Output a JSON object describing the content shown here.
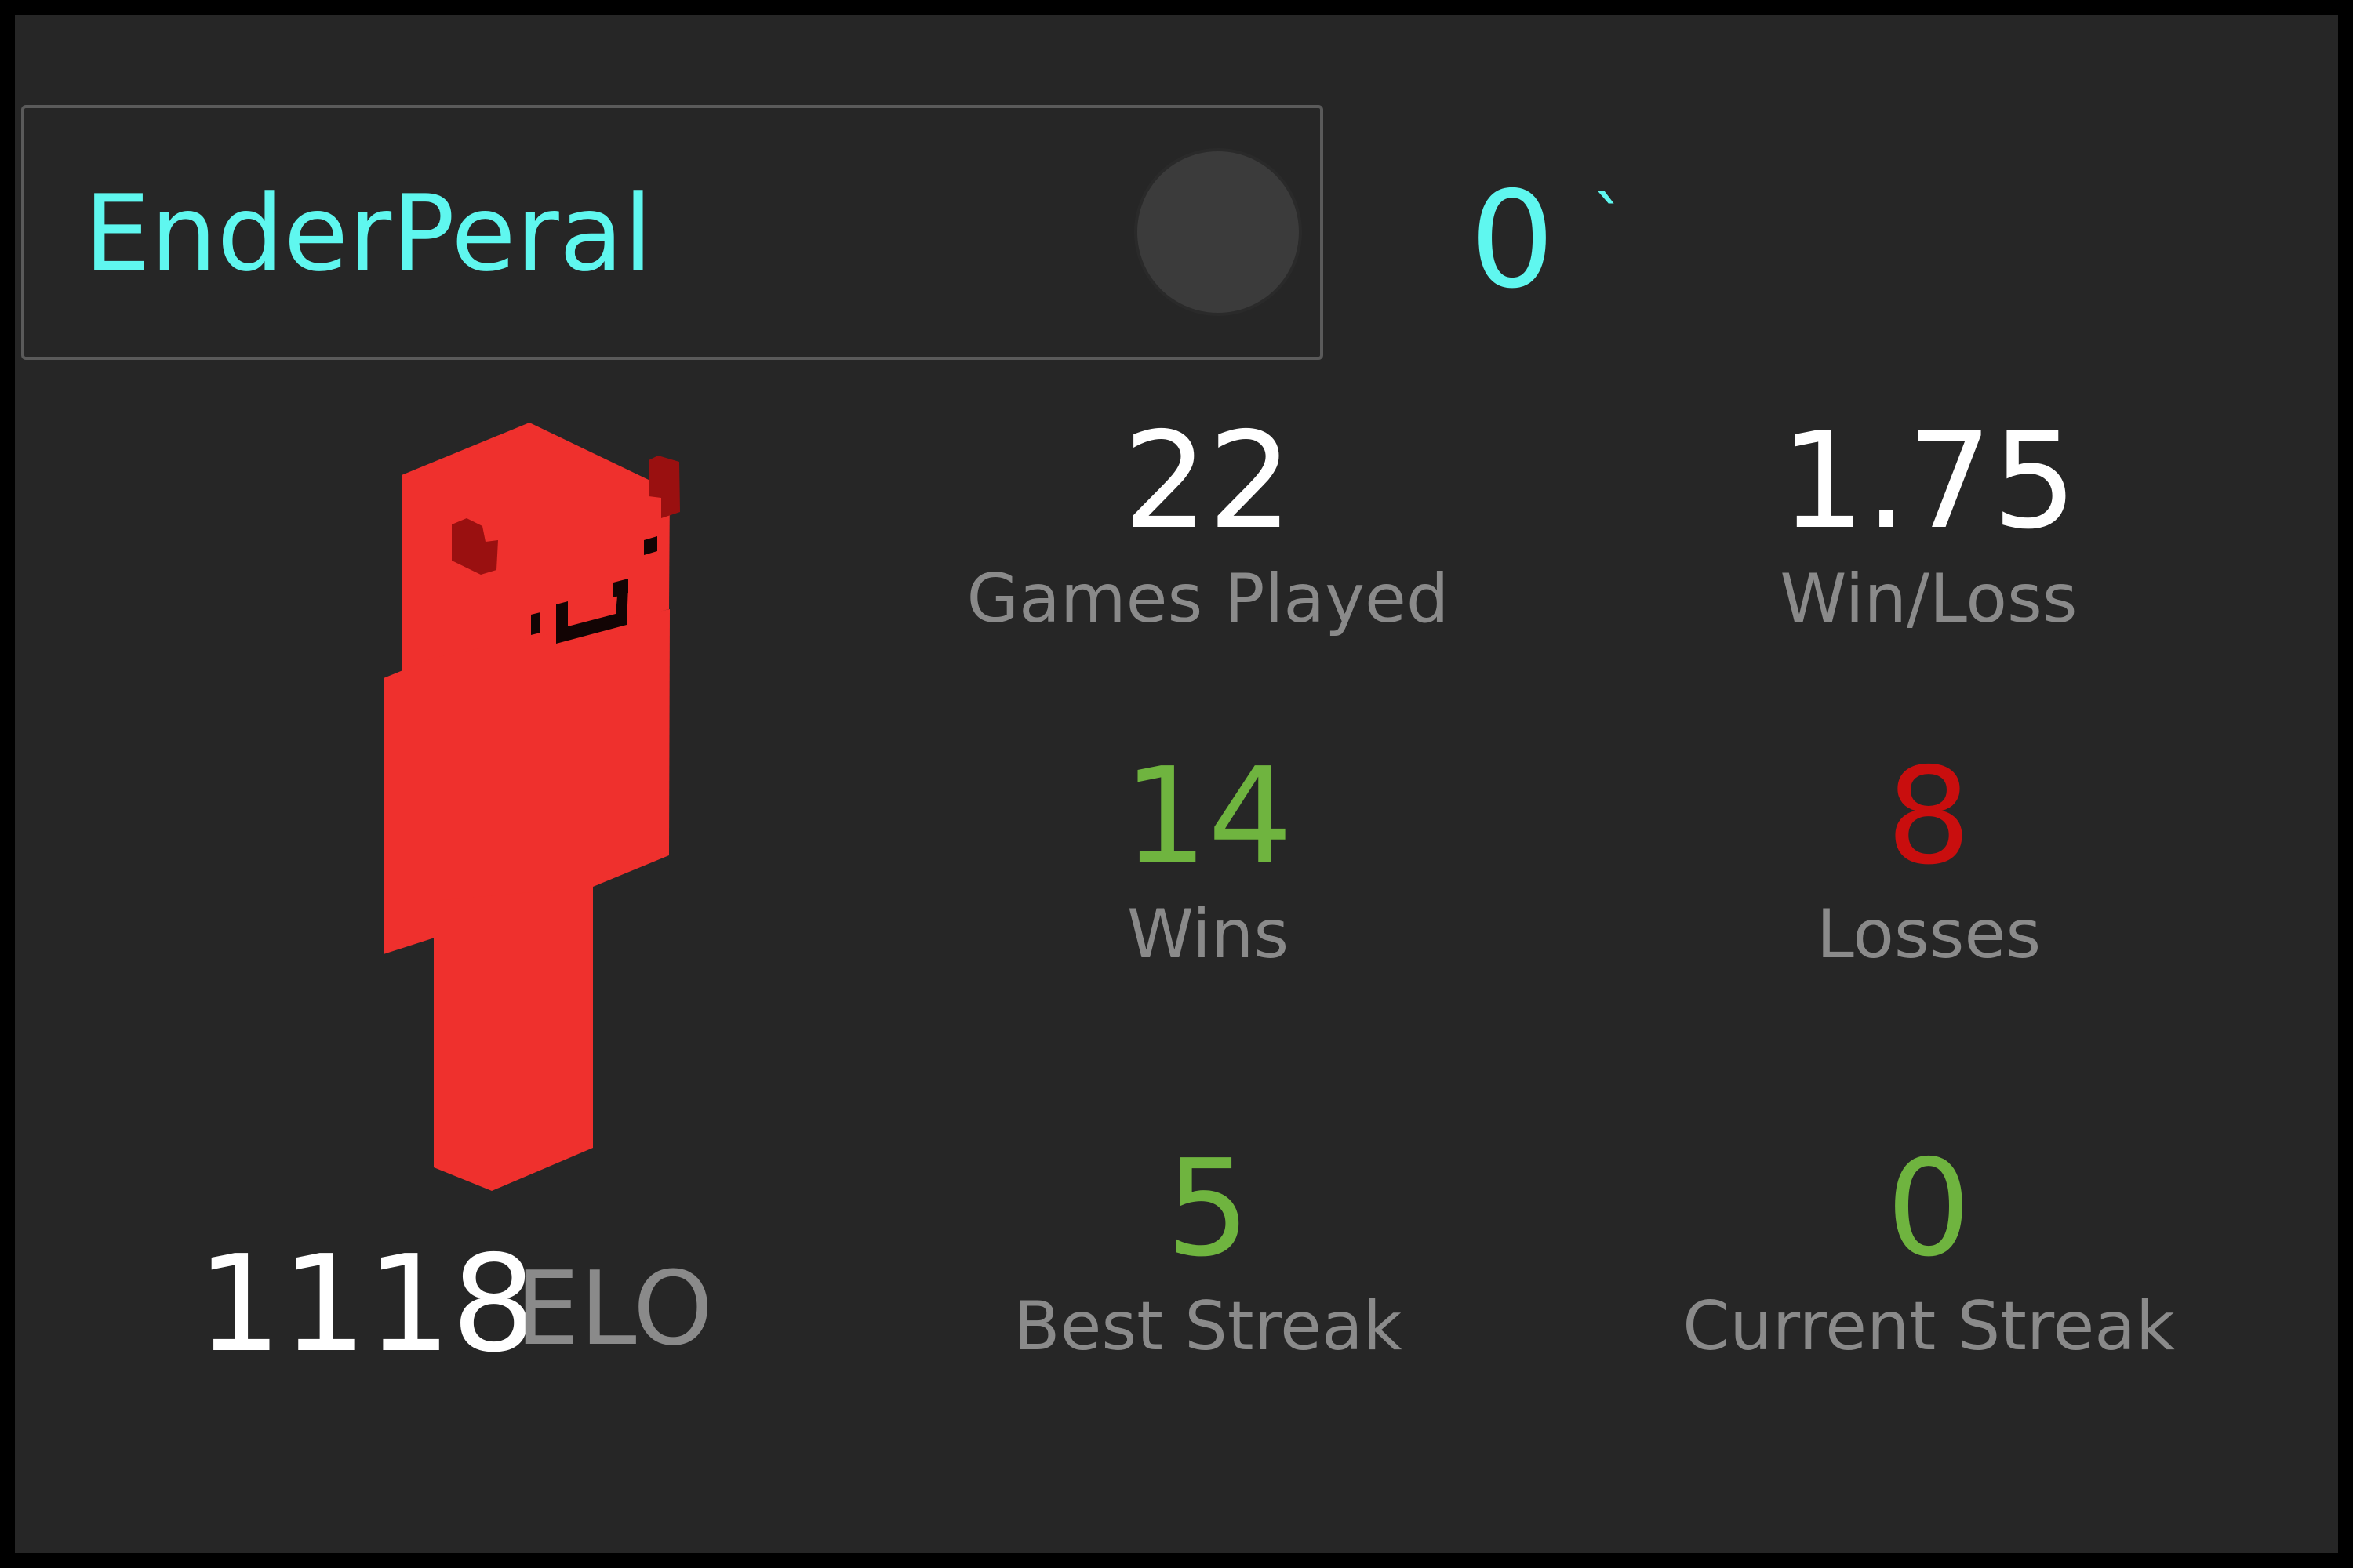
{
  "player": {
    "name": "EnderPeral",
    "header_value": "0",
    "header_mark": "`",
    "avatar_icon": "avatar-circle-icon",
    "skin_icon": "player-skin-icon"
  },
  "rating": {
    "value": "1118",
    "unit": "ELO"
  },
  "stats": {
    "games_played": {
      "value": "22",
      "label": "Games Played"
    },
    "win_loss": {
      "value": "1.75",
      "label": "Win/Loss"
    },
    "wins": {
      "value": "14",
      "label": "Wins"
    },
    "losses": {
      "value": "8",
      "label": "Losses"
    },
    "best_streak": {
      "value": "5",
      "label": "Best Streak"
    },
    "current_streak": {
      "value": "0",
      "label": "Current Streak"
    }
  },
  "colors": {
    "background": "#262626",
    "border": "#000000",
    "accent_cyan": "#5ff7ef",
    "win_green": "#6fb43f",
    "loss_red": "#c90e0e",
    "label_gray": "#8a8a8a",
    "skin_red": "#ef302d"
  }
}
